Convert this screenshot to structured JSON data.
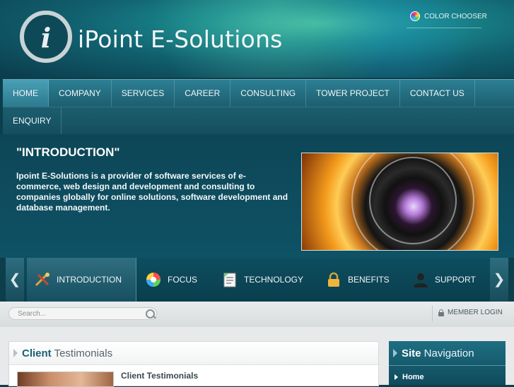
{
  "header": {
    "logo_letter": "i",
    "brand_name": "iPoint E-Solutions",
    "color_chooser_label": "COLOR CHOOSER"
  },
  "nav": {
    "items": [
      {
        "label": "HOME"
      },
      {
        "label": "COMPANY"
      },
      {
        "label": "SERVICES"
      },
      {
        "label": "CAREER"
      },
      {
        "label": "CONSULTING"
      },
      {
        "label": "TOWER PROJECT"
      },
      {
        "label": "CONTACT US"
      },
      {
        "label": "ENQUIRY"
      }
    ],
    "active": "HOME"
  },
  "intro": {
    "title": "\"INTRODUCTION\"",
    "body": "Ipoint E-Solutions is a provider of software services of e-commerce, web design and development and consulting to companies globally for online solutions, software development and database management."
  },
  "feature_tabs": {
    "prev_arrow": "❮",
    "next_arrow": "❯",
    "items": [
      {
        "label": "INTRODUCTION",
        "icon": "tools-icon"
      },
      {
        "label": "FOCUS",
        "icon": "color-wheel-icon"
      },
      {
        "label": "TECHNOLOGY",
        "icon": "document-icon"
      },
      {
        "label": "BENEFITS",
        "icon": "lock-icon"
      },
      {
        "label": "SUPPORT",
        "icon": "user-icon"
      }
    ],
    "active": "INTRODUCTION"
  },
  "search": {
    "placeholder": "Search..."
  },
  "member_login_label": "MEMBER LOGIN",
  "testimonials": {
    "title_bold": "Client",
    "title_rest": " Testimonials",
    "subheading": "Client Testimonials"
  },
  "site_navigation": {
    "title_bold": "Site",
    "title_rest": " Navigation",
    "items": [
      {
        "label": "Home"
      }
    ]
  },
  "colors": {
    "brand_teal": "#1c5f76",
    "header_green": "#3fb7a0",
    "nav_bg": "#1b5e6f",
    "content_bg": "#e7e9ea"
  }
}
